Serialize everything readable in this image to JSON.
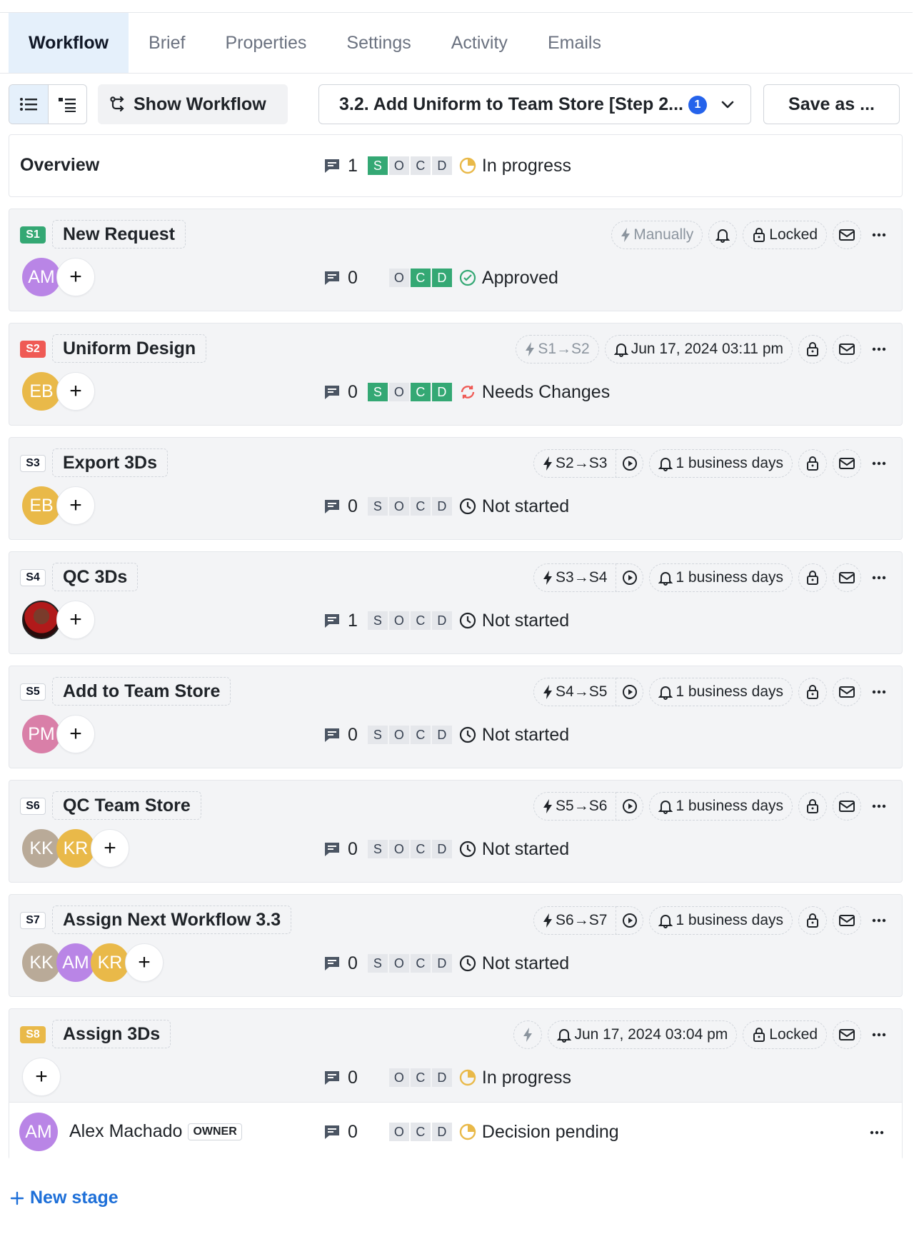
{
  "tabs": [
    "Workflow",
    "Brief",
    "Properties",
    "Settings",
    "Activity",
    "Emails"
  ],
  "toolbar": {
    "show_workflow": "Show Workflow",
    "workflow_select": "3.2. Add Uniform to Team Store [Step 2...",
    "workflow_badge": "1",
    "save_as": "Save as ..."
  },
  "overview": {
    "title": "Overview",
    "comments": "1",
    "soc": [
      "S",
      "O",
      "C",
      "D"
    ],
    "status": "In progress"
  },
  "stages": [
    {
      "id": "S1",
      "name": "New Request",
      "trigger": "Manually",
      "due": "",
      "lock": "Locked",
      "assignees": [
        "AM"
      ],
      "comments": "0",
      "soc": [
        "O",
        "C",
        "D"
      ],
      "status": "Approved"
    },
    {
      "id": "S2",
      "name": "Uniform Design",
      "trigger": "S1→S2",
      "due": "Jun 17, 2024 03:11 pm",
      "lock": "",
      "assignees": [
        "EB"
      ],
      "comments": "0",
      "soc": [
        "S",
        "O",
        "C",
        "D"
      ],
      "status": "Needs Changes"
    },
    {
      "id": "S3",
      "name": "Export 3Ds",
      "trigger": "S2→S3",
      "due": "1 business days",
      "lock": "",
      "assignees": [
        "EB"
      ],
      "comments": "0",
      "soc": [
        "S",
        "O",
        "C",
        "D"
      ],
      "status": "Not started"
    },
    {
      "id": "S4",
      "name": "QC 3Ds",
      "trigger": "S3→S4",
      "due": "1 business days",
      "lock": "",
      "assignees": [],
      "comments": "1",
      "soc": [
        "S",
        "O",
        "C",
        "D"
      ],
      "status": "Not started"
    },
    {
      "id": "S5",
      "name": "Add to Team Store",
      "trigger": "S4→S5",
      "due": "1 business days",
      "lock": "",
      "assignees": [
        "PM"
      ],
      "comments": "0",
      "soc": [
        "S",
        "O",
        "C",
        "D"
      ],
      "status": "Not started"
    },
    {
      "id": "S6",
      "name": "QC Team Store",
      "trigger": "S5→S6",
      "due": "1 business days",
      "lock": "",
      "assignees": [
        "KK",
        "KR"
      ],
      "comments": "0",
      "soc": [
        "S",
        "O",
        "C",
        "D"
      ],
      "status": "Not started"
    },
    {
      "id": "S7",
      "name": "Assign Next Workflow 3.3",
      "trigger": "S6→S7",
      "due": "1 business days",
      "lock": "",
      "assignees": [
        "KK",
        "AM",
        "KR"
      ],
      "comments": "0",
      "soc": [
        "S",
        "O",
        "C",
        "D"
      ],
      "status": "Not started"
    },
    {
      "id": "S8",
      "name": "Assign 3Ds",
      "trigger": "",
      "due": "Jun 17, 2024 03:04 pm",
      "lock": "Locked",
      "assignees": [],
      "comments": "0",
      "soc": [
        "O",
        "C",
        "D"
      ],
      "status": "In progress"
    }
  ],
  "owner": {
    "initials": "AM",
    "name": "Alex Machado",
    "badge": "OWNER",
    "comments": "0",
    "soc": [
      "O",
      "C",
      "D"
    ],
    "status": "Decision pending"
  },
  "new_stage": "New stage",
  "colors": {
    "accent": "#1d6fd8",
    "tab_active_bg": "#e5f0fb",
    "green": "#34a874",
    "red_tag": "#ef5a55",
    "yellow_tag": "#e9b949",
    "avatar_purple": "#b985e6",
    "avatar_yellow": "#e9b949",
    "avatar_pink": "#d97fa8",
    "avatar_gray": "#b9aa98"
  }
}
